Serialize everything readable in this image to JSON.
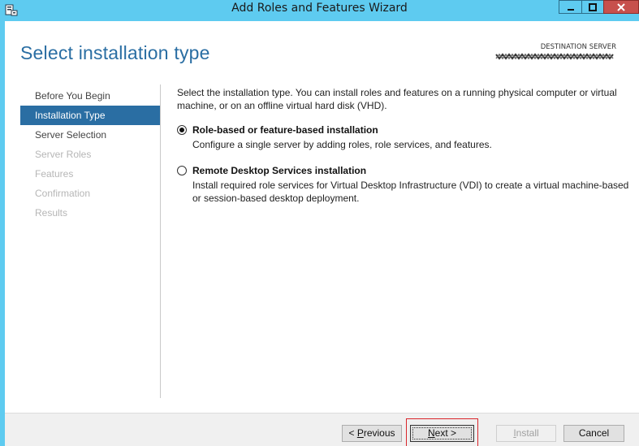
{
  "window": {
    "title": "Add Roles and Features Wizard",
    "minimize_glyph": "_",
    "maximize_glyph": "□",
    "close_glyph": "✕"
  },
  "header": {
    "page_title": "Select installation type",
    "destination_label": "DESTINATION SERVER",
    "destination_server": "(redacted)"
  },
  "nav": {
    "items": [
      {
        "label": "Before You Begin",
        "state": "normal"
      },
      {
        "label": "Installation Type",
        "state": "active"
      },
      {
        "label": "Server Selection",
        "state": "normal"
      },
      {
        "label": "Server Roles",
        "state": "disabled"
      },
      {
        "label": "Features",
        "state": "disabled"
      },
      {
        "label": "Confirmation",
        "state": "disabled"
      },
      {
        "label": "Results",
        "state": "disabled"
      }
    ]
  },
  "main": {
    "intro": "Select the installation type. You can install roles and features on a running physical computer or virtual machine, or on an offline virtual hard disk (VHD).",
    "options": [
      {
        "title": "Role-based or feature-based installation",
        "description": "Configure a single server by adding roles, role services, and features.",
        "selected": true
      },
      {
        "title": "Remote Desktop Services installation",
        "description": "Install required role services for Virtual Desktop Infrastructure (VDI) to create a virtual machine-based or session-based desktop deployment.",
        "selected": false
      }
    ]
  },
  "footer": {
    "previous": {
      "prefix": "< ",
      "accel": "P",
      "rest": "revious"
    },
    "next": {
      "accel": "N",
      "rest": "ext >"
    },
    "install": {
      "accel": "I",
      "rest": "nstall"
    },
    "cancel": "Cancel"
  },
  "colors": {
    "titlebar": "#5ecbf0",
    "accent": "#2a6ea3",
    "close_button": "#c7504c",
    "highlight_border": "#d9252b"
  }
}
